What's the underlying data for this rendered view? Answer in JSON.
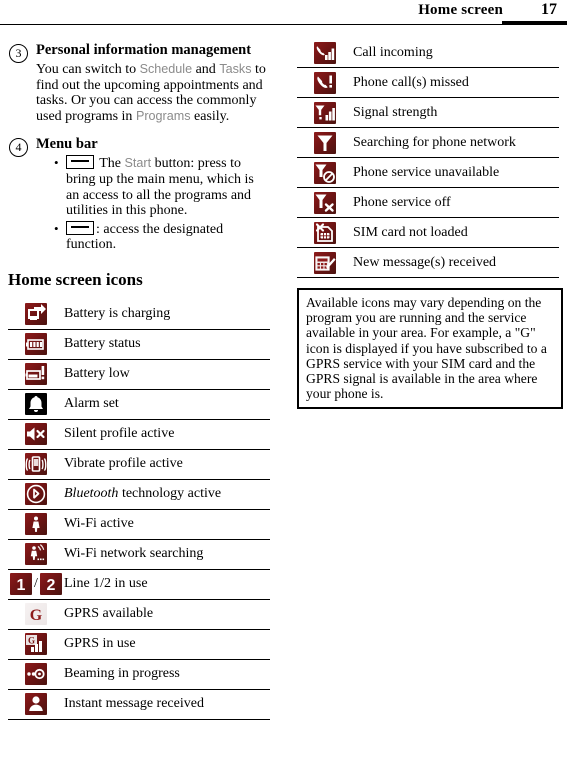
{
  "header": {
    "title": "Home screen",
    "page_number": "17"
  },
  "sections": [
    {
      "number": "3",
      "title": "Personal information management",
      "body_parts": [
        {
          "type": "text",
          "text": "You can switch to "
        },
        {
          "type": "term",
          "text": "Schedule"
        },
        {
          "type": "text",
          "text": " and "
        },
        {
          "type": "term",
          "text": "Tasks"
        },
        {
          "type": "text",
          "text": " to find out the upcoming appointments and tasks. Or you can access the commonly used programs in "
        },
        {
          "type": "term",
          "text": "Programs"
        },
        {
          "type": "text",
          "text": " easily."
        }
      ]
    },
    {
      "number": "4",
      "title": "Menu bar",
      "bullets": [
        {
          "icon": "softkey-icon",
          "parts": [
            {
              "type": "text",
              "text": " The "
            },
            {
              "type": "term",
              "text": "Start"
            },
            {
              "type": "text",
              "text": " button: press to bring up the main menu, which is an access to all the programs and utilities in this phone."
            }
          ]
        },
        {
          "icon": "softkey-icon",
          "parts": [
            {
              "type": "text",
              "text": ": access the designated function."
            }
          ]
        }
      ]
    }
  ],
  "icons_heading": "Home screen icons",
  "left_table": {
    "rows": [
      {
        "icon": "battery-charging-icon",
        "label": "Battery is charging"
      },
      {
        "icon": "battery-status-icon",
        "label": "Battery status"
      },
      {
        "icon": "battery-low-icon",
        "label": "Battery low"
      },
      {
        "icon": "alarm-set-icon",
        "label": "Alarm set"
      },
      {
        "icon": "silent-profile-icon",
        "label": "Silent profile active"
      },
      {
        "icon": "vibrate-profile-icon",
        "label": "Vibrate profile active"
      },
      {
        "icon": "bluetooth-icon",
        "label": "Bluetooth technology active",
        "italic_prefix": "Bluetooth",
        "rest": " technology active"
      },
      {
        "icon": "wifi-active-icon",
        "label": "Wi-Fi active"
      },
      {
        "icon": "wifi-searching-icon",
        "label": "Wi-Fi network searching"
      },
      {
        "icon": "line-1-2-icon",
        "label": "Line 1/2 in use",
        "separator": "/"
      },
      {
        "icon": "gprs-available-icon",
        "label": "GPRS available"
      },
      {
        "icon": "gprs-in-use-icon",
        "label": "GPRS in use"
      },
      {
        "icon": "beaming-icon",
        "label": "Beaming in progress"
      },
      {
        "icon": "instant-message-icon",
        "label": "Instant message received"
      }
    ]
  },
  "right_table": {
    "rows": [
      {
        "icon": "call-incoming-icon",
        "label": "Call incoming"
      },
      {
        "icon": "missed-call-icon",
        "label": "Phone call(s) missed"
      },
      {
        "icon": "signal-strength-icon",
        "label": "Signal strength"
      },
      {
        "icon": "searching-network-icon",
        "label": "Searching for phone network"
      },
      {
        "icon": "service-unavailable-icon",
        "label": "Phone service unavailable"
      },
      {
        "icon": "service-off-icon",
        "label": "Phone service off"
      },
      {
        "icon": "sim-not-loaded-icon",
        "label": "SIM card not loaded"
      },
      {
        "icon": "new-message-icon",
        "label": "New message(s) received"
      }
    ]
  },
  "note": {
    "text": "Available icons may vary depending on the program you are running and the service available in your area. For example, a \"G\" icon is displayed if you have subscribed to a GPRS service with your SIM card and the GPRS signal is available in the area where your phone is."
  },
  "colors": {
    "icon_red": "#8d1b1b",
    "icon_red_dark": "#4a1410",
    "term_gray": "#8b8b8b",
    "rule_black": "#000000"
  }
}
